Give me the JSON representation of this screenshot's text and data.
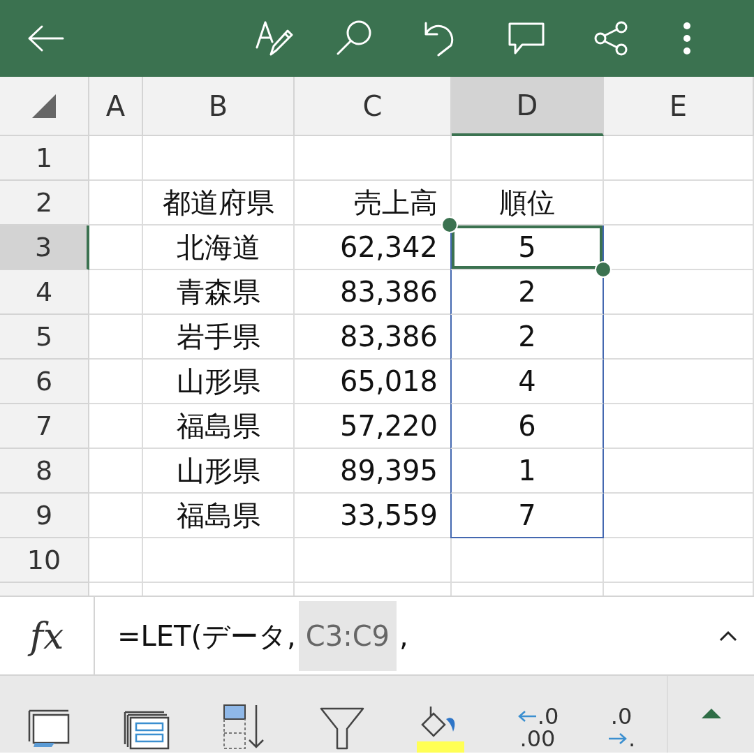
{
  "columns": [
    {
      "label": "A",
      "selected": false
    },
    {
      "label": "B",
      "selected": false
    },
    {
      "label": "C",
      "selected": false
    },
    {
      "label": "D",
      "selected": true
    },
    {
      "label": "E",
      "selected": false
    }
  ],
  "rows": [
    {
      "label": "1",
      "selected": false,
      "cells": [
        {
          "selected": false,
          "active": false
        },
        {
          "selected": false,
          "active": false
        },
        {
          "selected": false,
          "active": false
        },
        {
          "selected": false,
          "active": false
        },
        {
          "selected": false,
          "active": false
        }
      ]
    },
    {
      "label": "2",
      "selected": false,
      "cells": [
        {
          "selected": false,
          "active": false
        },
        {
          "text": "都道府県",
          "selected": false,
          "active": false
        },
        {
          "text": "売上高",
          "selected": false,
          "active": false
        },
        {
          "text": "順位",
          "selected": false,
          "active": false
        },
        {
          "selected": false,
          "active": false
        }
      ]
    },
    {
      "label": "3",
      "selected": true,
      "cells": [
        {
          "selected": false,
          "active": false
        },
        {
          "text": "北海道",
          "selected": false,
          "active": false
        },
        {
          "text": "62,342",
          "selected": false,
          "active": false
        },
        {
          "text": "5",
          "selected": true,
          "active": true
        },
        {
          "selected": false,
          "active": false
        }
      ]
    },
    {
      "label": "4",
      "selected": false,
      "cells": [
        {
          "selected": false,
          "active": false
        },
        {
          "text": "青森県",
          "selected": false,
          "active": false
        },
        {
          "text": "83,386",
          "selected": false,
          "active": false
        },
        {
          "text": "2",
          "selected": true,
          "active": false
        },
        {
          "selected": false,
          "active": false
        }
      ]
    },
    {
      "label": "5",
      "selected": false,
      "cells": [
        {
          "selected": false,
          "active": false
        },
        {
          "text": "岩手県",
          "selected": false,
          "active": false
        },
        {
          "text": "83,386",
          "selected": false,
          "active": false
        },
        {
          "text": "2",
          "selected": true,
          "active": false
        },
        {
          "selected": false,
          "active": false
        }
      ]
    },
    {
      "label": "6",
      "selected": false,
      "cells": [
        {
          "selected": false,
          "active": false
        },
        {
          "text": "山形県",
          "selected": false,
          "active": false
        },
        {
          "text": "65,018",
          "selected": false,
          "active": false
        },
        {
          "text": "4",
          "selected": true,
          "active": false
        },
        {
          "selected": false,
          "active": false
        }
      ]
    },
    {
      "label": "7",
      "selected": false,
      "cells": [
        {
          "selected": false,
          "active": false
        },
        {
          "text": "福島県",
          "selected": false,
          "active": false
        },
        {
          "text": "57,220",
          "selected": false,
          "active": false
        },
        {
          "text": "6",
          "selected": true,
          "active": false
        },
        {
          "selected": false,
          "active": false
        }
      ]
    },
    {
      "label": "8",
      "selected": false,
      "cells": [
        {
          "selected": false,
          "active": false
        },
        {
          "text": "山形県",
          "selected": false,
          "active": false
        },
        {
          "text": "89,395",
          "selected": false,
          "active": false
        },
        {
          "text": "1",
          "selected": true,
          "active": false
        },
        {
          "selected": false,
          "active": false
        }
      ]
    },
    {
      "label": "9",
      "selected": false,
      "cells": [
        {
          "selected": false,
          "active": false
        },
        {
          "text": "福島県",
          "selected": false,
          "active": false
        },
        {
          "text": "33,559",
          "selected": false,
          "active": false
        },
        {
          "text": "7",
          "selected": true,
          "active": false
        },
        {
          "selected": false,
          "active": false
        }
      ]
    },
    {
      "label": "10",
      "selected": false,
      "cells": [
        {
          "selected": false,
          "active": false
        },
        {
          "selected": false,
          "active": false
        },
        {
          "selected": false,
          "active": false
        },
        {
          "selected": false,
          "active": false
        },
        {
          "selected": false,
          "active": false
        }
      ]
    }
  ],
  "formula_bar": {
    "fx": "fx",
    "parts": [
      {
        "text": "=LET(データ,",
        "highlighted": false
      },
      {
        "text": "C3:C9",
        "highlighted": true
      },
      {
        "text": ",",
        "highlighted": false
      }
    ]
  },
  "toolbar": [
    {
      "kind": "borders"
    },
    {
      "kind": "table"
    },
    {
      "kind": "insert"
    },
    {
      "kind": "filter"
    },
    {
      "kind": "fill"
    },
    {
      "kind": "dec-up",
      "top": ".0",
      "bottom": ".00"
    },
    {
      "kind": "dec-down",
      "top": ".0",
      "bottom": "."
    },
    {
      "kind": "expand"
    }
  ]
}
